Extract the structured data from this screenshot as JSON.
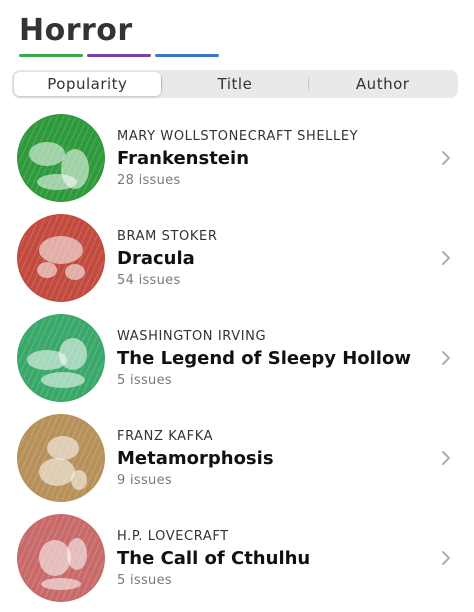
{
  "header": {
    "title": "Horror",
    "underline_colors": [
      "#3aa84a",
      "#7b3fa8",
      "#3b77c4"
    ]
  },
  "tabs": [
    {
      "label": "Popularity",
      "selected": true
    },
    {
      "label": "Title",
      "selected": false
    },
    {
      "label": "Author",
      "selected": false
    }
  ],
  "books": [
    {
      "author": "MARY WOLLSTONECRAFT SHELLEY",
      "title": "Frankenstein",
      "issues": "28 issues",
      "cover_color": "#2e9a3c",
      "cover_icon": "frankenstein-cover"
    },
    {
      "author": "BRAM STOKER",
      "title": "Dracula",
      "issues": "54 issues",
      "cover_color": "#c24a3e",
      "cover_icon": "dracula-cover"
    },
    {
      "author": "WASHINGTON IRVING",
      "title": "The Legend of Sleepy Hollow",
      "issues": "5 issues",
      "cover_color": "#3aa86a",
      "cover_icon": "sleepy-hollow-cover"
    },
    {
      "author": "FRANZ KAFKA",
      "title": "Metamorphosis",
      "issues": "9 issues",
      "cover_color": "#b8915a",
      "cover_icon": "metamorphosis-cover"
    },
    {
      "author": "H.P. LOVECRAFT",
      "title": "The Call of Cthulhu",
      "issues": "5 issues",
      "cover_color": "#c96a6a",
      "cover_icon": "cthulhu-cover"
    }
  ]
}
